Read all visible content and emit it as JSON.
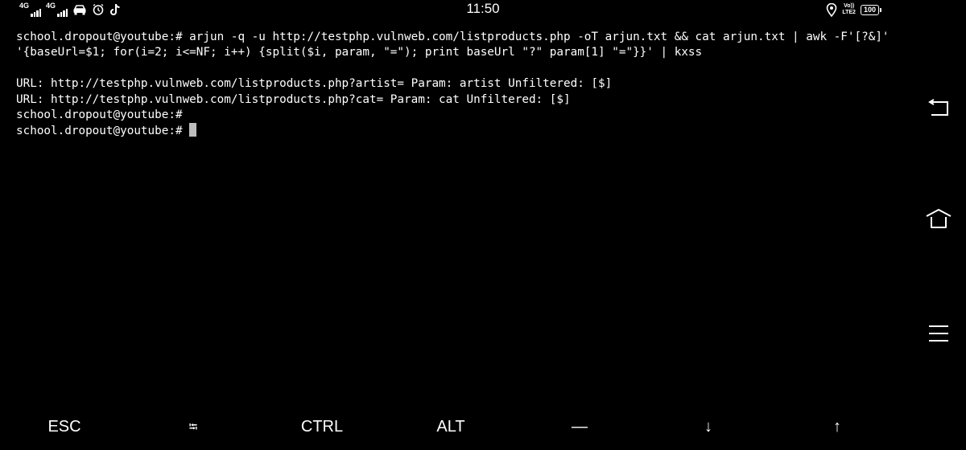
{
  "status_bar": {
    "time": "11:50",
    "network_1": "4G",
    "network_2": "4G",
    "volte_top": "Vo))",
    "volte_bottom": "LTE2",
    "battery": "100",
    "icons": [
      "signal-icon",
      "signal-icon",
      "car-icon",
      "alarm-icon",
      "tiktok-icon",
      "location-icon",
      "volte-icon",
      "battery-icon"
    ]
  },
  "terminal": {
    "lines": [
      "school.dropout@youtube:# arjun -q -u http://testphp.vulnweb.com/listproducts.php -oT arjun.txt && cat arjun.txt | awk -F'[?&]' '{baseUrl=$1; for(i=2; i<=NF; i++) {split($i, param, \"=\"); print baseUrl \"?\" param[1] \"=\"}}' | kxss",
      "",
      "URL: http://testphp.vulnweb.com/listproducts.php?artist= Param: artist Unfiltered: [$]",
      "URL: http://testphp.vulnweb.com/listproducts.php?cat= Param: cat Unfiltered: [$]",
      "school.dropout@youtube:#"
    ],
    "prompt": "school.dropout@youtube:# ",
    "cursor_color": "#bdbdbd",
    "background": "#000000",
    "foreground": "#ffffff"
  },
  "nav": {
    "icons": [
      "back-icon",
      "home-icon",
      "menu-icon"
    ]
  },
  "extra_keys": {
    "esc": "ESC",
    "tab": "⭾",
    "ctrl": "CTRL",
    "alt": "ALT",
    "dash": "—",
    "down": "↓",
    "up": "↑"
  }
}
